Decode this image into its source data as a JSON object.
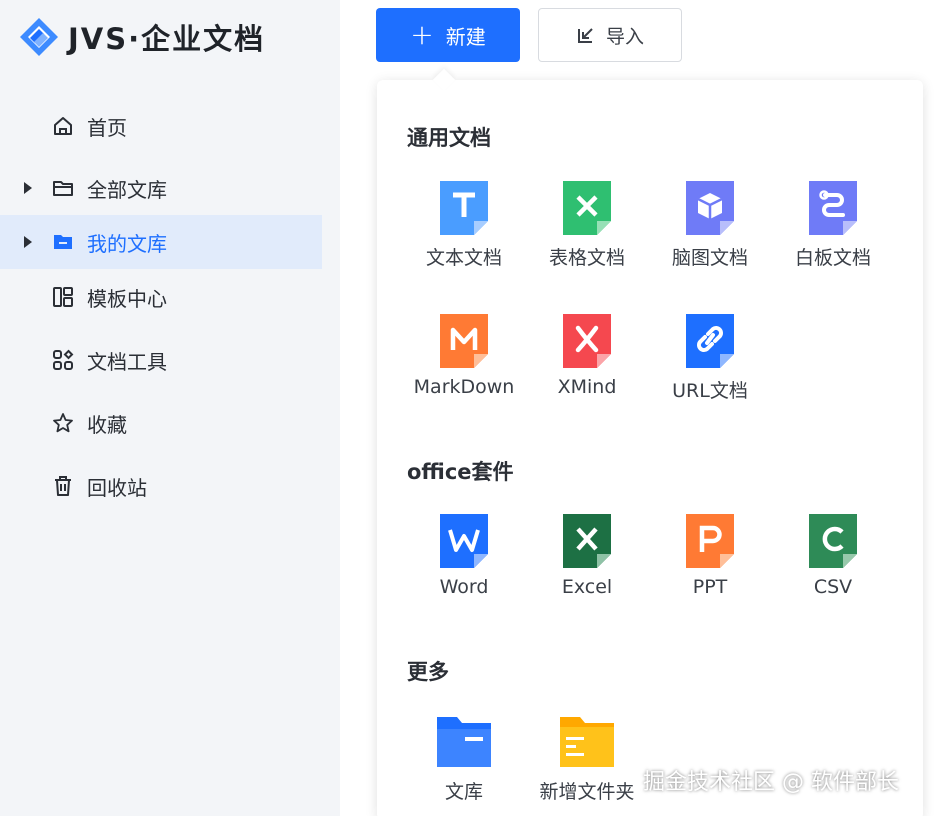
{
  "app": {
    "logo_text": "JVS·企业文档"
  },
  "sidebar": {
    "items": [
      {
        "label": "首页",
        "icon": "home-icon",
        "has_arrow": false,
        "active": false
      },
      {
        "label": "全部文库",
        "icon": "folder-icon",
        "has_arrow": true,
        "active": false
      },
      {
        "label": "我的文库",
        "icon": "folder-filled-icon",
        "has_arrow": true,
        "active": true
      },
      {
        "label": "模板中心",
        "icon": "template-icon",
        "has_arrow": false,
        "active": false
      },
      {
        "label": "文档工具",
        "icon": "tools-icon",
        "has_arrow": false,
        "active": false
      },
      {
        "label": "收藏",
        "icon": "star-icon",
        "has_arrow": false,
        "active": false
      },
      {
        "label": "回收站",
        "icon": "trash-icon",
        "has_arrow": false,
        "active": false
      }
    ]
  },
  "toolbar": {
    "new_label": "新建",
    "import_label": "导入"
  },
  "menu": {
    "sections": [
      {
        "title": "通用文档"
      },
      {
        "title": "office套件"
      },
      {
        "title": "更多"
      }
    ],
    "general": [
      {
        "label": "文本文档",
        "icon": "text-doc-icon",
        "color": "#4a9dff",
        "glyph": "T"
      },
      {
        "label": "表格文档",
        "icon": "sheet-doc-icon",
        "color": "#2fbf71",
        "glyph": "✕"
      },
      {
        "label": "脑图文档",
        "icon": "mindmap-doc-icon",
        "color": "#6f7bf7",
        "glyph": "cube"
      },
      {
        "label": "白板文档",
        "icon": "whiteboard-doc-icon",
        "color": "#6f7bf7",
        "glyph": "wb"
      },
      {
        "label": "MarkDown",
        "icon": "markdown-doc-icon",
        "color": "#ff7a34",
        "glyph": "M"
      },
      {
        "label": "XMind",
        "icon": "xmind-doc-icon",
        "color": "#f5484f",
        "glyph": "X"
      },
      {
        "label": "URL文档",
        "icon": "url-doc-icon",
        "color": "#1e6fff",
        "glyph": "link"
      }
    ],
    "office": [
      {
        "label": "Word",
        "icon": "word-doc-icon",
        "color": "#1e6fff",
        "glyph": "W"
      },
      {
        "label": "Excel",
        "icon": "excel-doc-icon",
        "color": "#1d7044",
        "glyph": "X"
      },
      {
        "label": "PPT",
        "icon": "ppt-doc-icon",
        "color": "#ff7a34",
        "glyph": "P"
      },
      {
        "label": "CSV",
        "icon": "csv-doc-icon",
        "color": "#2e8b57",
        "glyph": "C"
      }
    ],
    "more": [
      {
        "label": "文库",
        "icon": "library-folder-icon",
        "color": "#1e6fff"
      },
      {
        "label": "新增文件夹",
        "icon": "new-folder-icon",
        "color": "#ffc21a"
      }
    ]
  },
  "watermark": "掘金技术社区 @ 软件部长"
}
